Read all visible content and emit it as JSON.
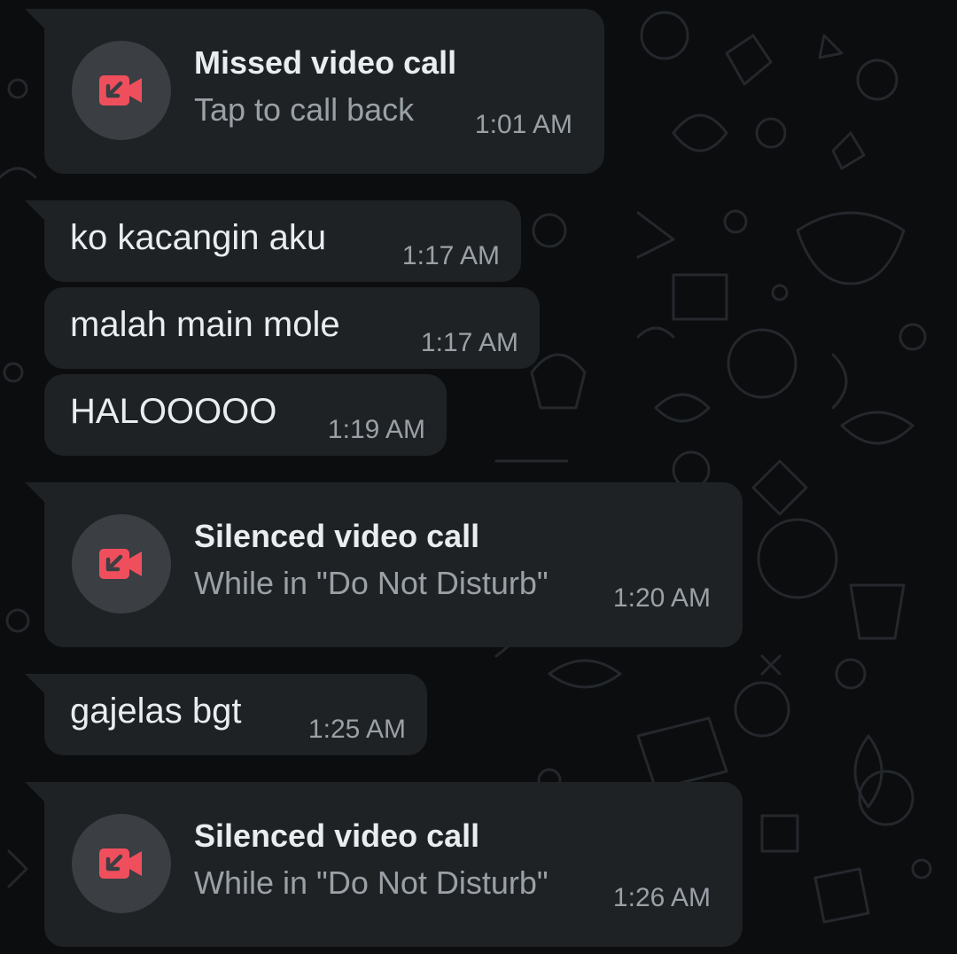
{
  "colors": {
    "background": "#0b0d0f",
    "bubble": "#1f2225",
    "text_primary": "#e9edef",
    "text_secondary": "#9aa1a6",
    "call_icon_bg": "#3b3e42",
    "call_icon_accent": "#ef4f5d"
  },
  "messages": [
    {
      "type": "call",
      "icon": "missed-video-call-icon",
      "title": "Missed video call",
      "subtitle": "Tap to call back",
      "time": "1:01 AM"
    },
    {
      "type": "text",
      "text": "ko kacangin aku",
      "time": "1:17 AM"
    },
    {
      "type": "text",
      "text": "malah main mole",
      "time": "1:17 AM"
    },
    {
      "type": "text",
      "text": "HALOOOOO",
      "time": "1:19 AM"
    },
    {
      "type": "call",
      "icon": "missed-video-call-icon",
      "title": "Silenced video call",
      "subtitle": "While in \"Do Not Disturb\"",
      "time": "1:20 AM"
    },
    {
      "type": "text",
      "text": "gajelas bgt",
      "time": "1:25 AM"
    },
    {
      "type": "call",
      "icon": "missed-video-call-icon",
      "title": "Silenced video call",
      "subtitle": "While in \"Do Not Disturb\"",
      "time": "1:26 AM"
    }
  ]
}
